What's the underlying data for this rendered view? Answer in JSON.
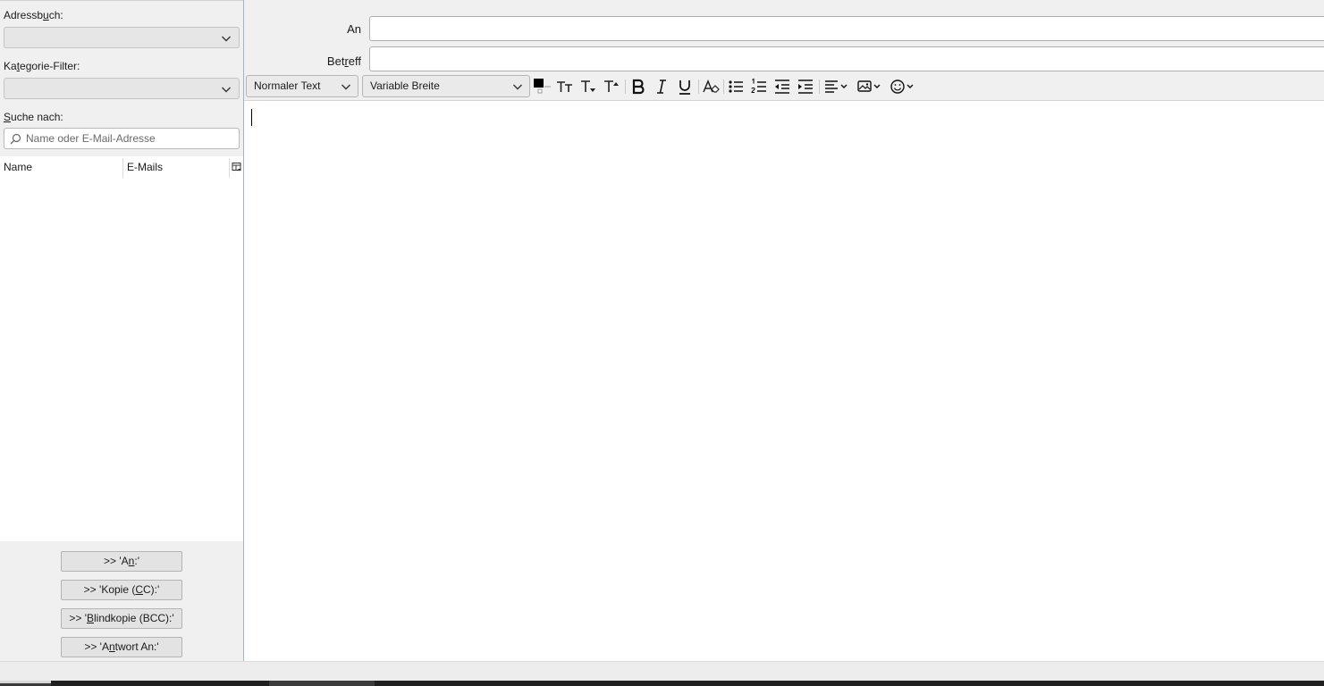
{
  "sidebar": {
    "addressbook_label_pre": "Adressb",
    "addressbook_label_key": "u",
    "addressbook_label_post": "ch:",
    "category_label_pre": "Ka",
    "category_label_key": "t",
    "category_label_post": "egorie-Filter:",
    "search_label_key": "S",
    "search_label_post": "uche nach:",
    "search_placeholder": "Name oder E-Mail-Adresse",
    "columns": [
      "Name",
      "E-Mails"
    ],
    "buttons": {
      "to": {
        "pre": ">> 'A",
        "key": "n",
        "post": ":'"
      },
      "cc": {
        "pre": ">> 'Kopie (",
        "key": "C",
        "post": "C):'"
      },
      "bcc": {
        "pre": ">> '",
        "key": "B",
        "post": "lindkopie (BCC):'"
      },
      "reply": {
        "pre": ">> 'A",
        "key": "n",
        "post": "twort An:'"
      }
    }
  },
  "compose": {
    "to_label": "An",
    "subject_label_pre": "Bet",
    "subject_label_key": "r",
    "subject_label_post": "eff",
    "to_value": "",
    "subject_value": ""
  },
  "toolbar": {
    "paragraph_format": "Normaler Text",
    "font_family": "Variable Breite",
    "text_color": "#000000",
    "icons": [
      "text-color-icon",
      "font-size-smaller-icon",
      "font-size-larger-icon",
      "bold-icon",
      "italic-icon",
      "underline-icon",
      "remove-formatting-icon",
      "bullet-list-icon",
      "numbered-list-icon",
      "outdent-icon",
      "indent-icon",
      "align-icon",
      "insert-image-icon",
      "emoji-icon"
    ]
  },
  "colors": {
    "splitter": "#9eb5c9",
    "background": "#f0f0f0"
  }
}
